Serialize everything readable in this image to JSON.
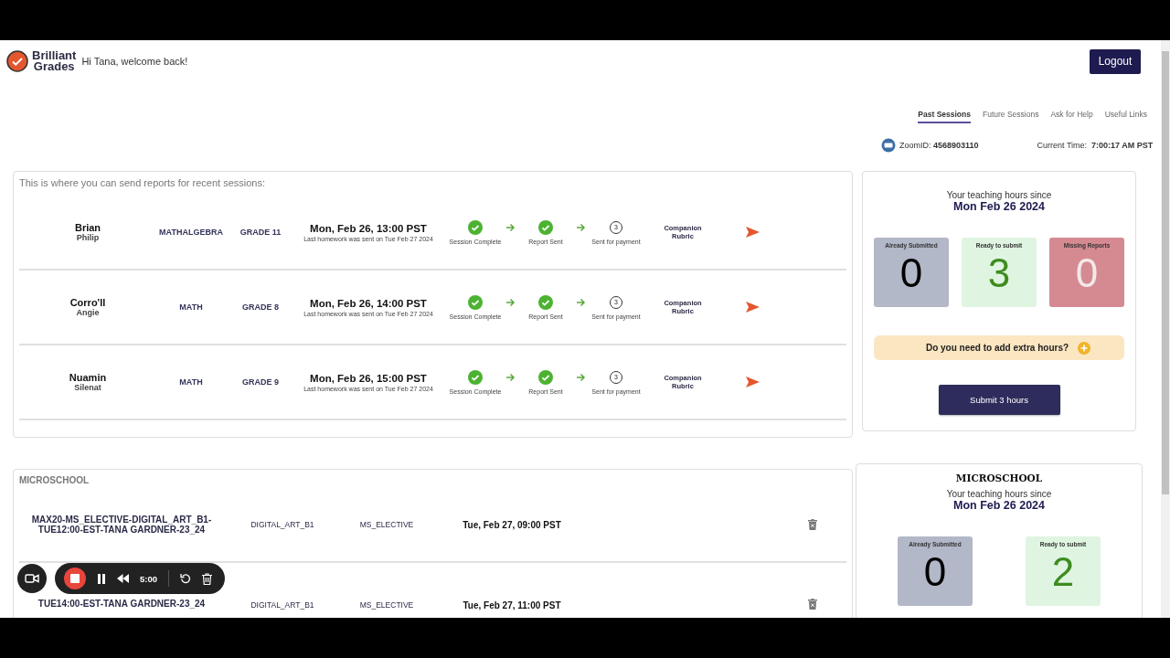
{
  "header": {
    "logo_line1": "Brilliant",
    "logo_line2": "Grades",
    "greeting": "Hi Tana, welcome back!",
    "logout": "Logout"
  },
  "nav": [
    {
      "label": "Past Sessions",
      "selected": true
    },
    {
      "label": "Future Sessions",
      "selected": false
    },
    {
      "label": "Ask for Help",
      "selected": false
    },
    {
      "label": "Useful Links",
      "selected": false
    }
  ],
  "zoom": {
    "label": "ZoomID:",
    "id": "4568903110"
  },
  "current_time": {
    "label": "Current Time:",
    "value": "7:00:17 AM PST"
  },
  "sessions": {
    "intro": "This is where you can send reports for recent sessions:",
    "rows": [
      {
        "last": "Brian",
        "first": "Philip",
        "subject": "MATHALGEBRA",
        "grade": "GRADE 11",
        "time": "Mon, Feb 26, 13:00 PST",
        "note": "Last homework was sent on Tue Feb 27 2024",
        "steps": [
          {
            "label": "Session Complete",
            "done": true
          },
          {
            "label": "Report Sent",
            "done": true
          },
          {
            "label": "Sent for payment",
            "done": false,
            "number": "3"
          }
        ],
        "rubric": "Companion Rubric"
      },
      {
        "last": "Corro'll",
        "first": "Angie",
        "subject": "MATH",
        "grade": "GRADE 8",
        "time": "Mon, Feb 26, 14:00 PST",
        "note": "Last homework was sent on Tue Feb 27 2024",
        "steps": [
          {
            "label": "Session Complete",
            "done": true
          },
          {
            "label": "Report Sent",
            "done": true
          },
          {
            "label": "Sent for payment",
            "done": false,
            "number": "3"
          }
        ],
        "rubric": "Companion Rubric"
      },
      {
        "last": "Nuamin",
        "first": "Silenat",
        "subject": "MATH",
        "grade": "GRADE 9",
        "time": "Mon, Feb 26, 15:00 PST",
        "note": "Last homework was sent on Tue Feb 27 2024",
        "steps": [
          {
            "label": "Session Complete",
            "done": true
          },
          {
            "label": "Report Sent",
            "done": true
          },
          {
            "label": "Sent for payment",
            "done": false,
            "number": "3"
          }
        ],
        "rubric": "Companion Rubric"
      }
    ]
  },
  "hours": {
    "intro": "Your teaching hours since",
    "date": "Mon Feb 26 2024",
    "stats": [
      {
        "kind": "submitted",
        "label": "Already Submitted",
        "value": "0"
      },
      {
        "kind": "ready",
        "label": "Ready to submit",
        "value": "3"
      },
      {
        "kind": "missing",
        "label": "Missing Reports",
        "value": "0"
      }
    ],
    "extra": "Do you need to add extra hours?",
    "submit": "Submit 3 hours"
  },
  "microschool": {
    "title": "MICROSCHOOL",
    "rows": [
      {
        "name": "MAX20-MS_ELECTIVE-DIGITAL_ART_B1-TUE12:00-EST-TANA GARDNER-23_24",
        "code": "DIGITAL_ART_B1",
        "type": "MS_ELECTIVE",
        "time": "Tue, Feb 27, 09:00 PST"
      },
      {
        "name": "TUE14:00-EST-TANA GARDNER-23_24",
        "code": "DIGITAL_ART_B1",
        "type": "MS_ELECTIVE",
        "time": "Tue, Feb 27, 11:00 PST"
      }
    ]
  },
  "micro_hours": {
    "title": "MICROSCHOOL",
    "intro": "Your teaching hours since",
    "date": "Mon Feb 26 2024",
    "stats": [
      {
        "kind": "submitted",
        "label": "Already Submitted",
        "value": "0"
      },
      {
        "kind": "ready",
        "label": "Ready to submit",
        "value": "2"
      }
    ]
  },
  "recorder": {
    "time": "5:00"
  }
}
